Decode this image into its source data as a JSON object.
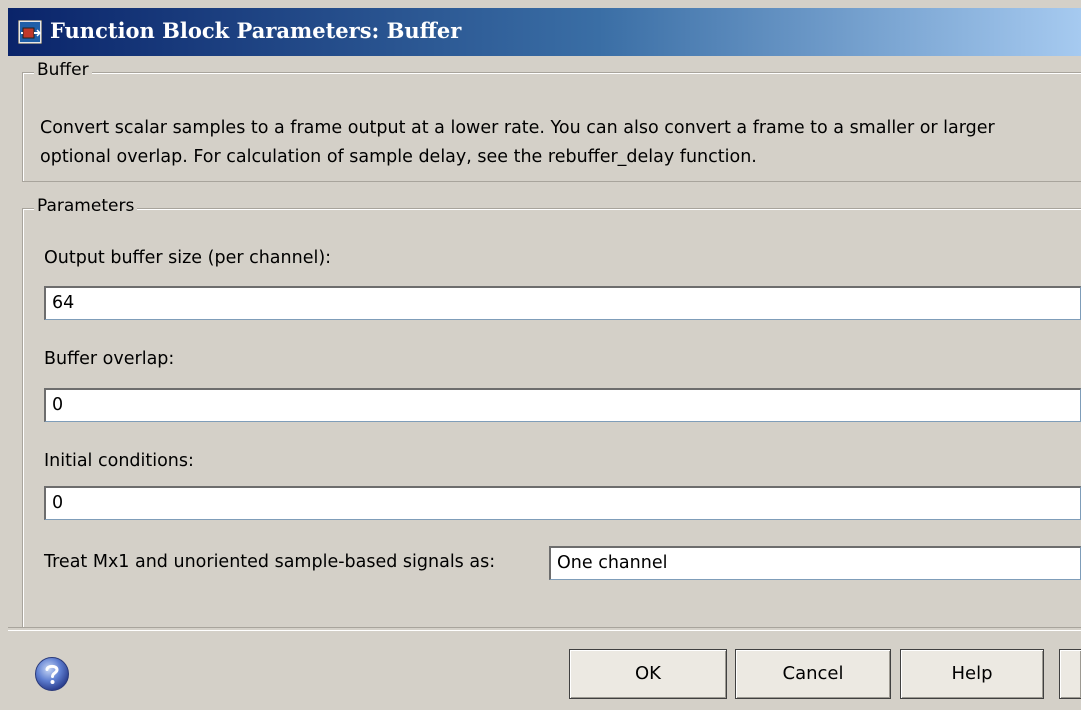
{
  "window": {
    "title": "Function Block Parameters: Buffer"
  },
  "description_group": {
    "legend": "Buffer",
    "line1": "Convert scalar samples to a frame output at a lower rate. You can also convert a frame to a smaller or larger",
    "line2": "optional overlap. For calculation of sample delay, see the rebuffer_delay function."
  },
  "parameters_group": {
    "legend": "Parameters",
    "output_buffer_size": {
      "label": "Output buffer size (per channel):",
      "value": "64"
    },
    "buffer_overlap": {
      "label": "Buffer overlap:",
      "value": "0"
    },
    "initial_conditions": {
      "label": "Initial conditions:",
      "value": "0"
    },
    "treat_signals": {
      "label": "Treat Mx1 and unoriented sample-based signals as:",
      "selected": "One channel"
    }
  },
  "buttons": {
    "ok": "OK",
    "cancel": "Cancel",
    "help": "Help",
    "apply": ""
  },
  "icons": {
    "window": "simulink-block-icon",
    "help": "help-question-icon"
  },
  "colors": {
    "title_start": "#0a246a",
    "title_end": "#a6caf0",
    "dialog_bg": "#d4d0c8"
  }
}
